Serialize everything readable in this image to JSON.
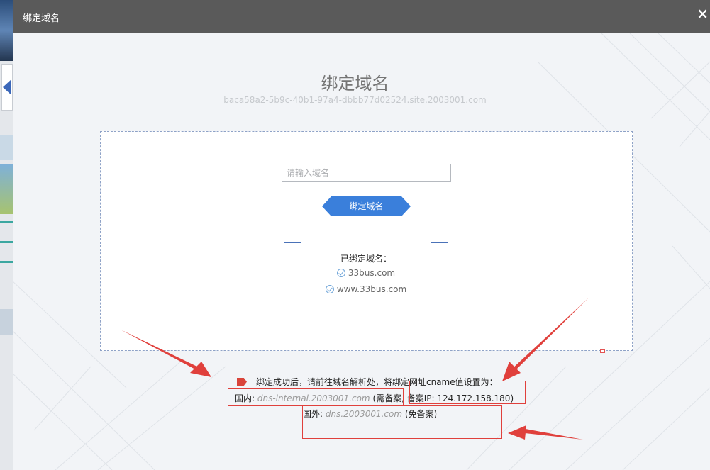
{
  "dialog": {
    "title": "绑定域名",
    "close_glyph": "×"
  },
  "main": {
    "heading": "绑定域名",
    "subtitle": "baca58a2-5b9c-40b1-97a4-dbbb77d02524.site.2003001.com"
  },
  "form": {
    "input_placeholder": "请输入域名",
    "input_value": "",
    "bind_button_label": "绑定域名"
  },
  "bound": {
    "label": "已绑定域名：",
    "domains": [
      "33bus.com",
      "www.33bus.com"
    ]
  },
  "instructions": {
    "intro": "绑定成功后，请前往域名解析处，将绑定网址cname值设置为：",
    "domestic_label": "国内: ",
    "domestic_host": "dns-internal.2003001.com",
    "domestic_note": " (需备案, 备案IP: 124.172.158.180)",
    "foreign_label": "国外: ",
    "foreign_host": "dns.2003001.com",
    "foreign_note": " (免备案)"
  },
  "colors": {
    "titlebar": "#5a5a5a",
    "button": "#3a7fdb",
    "annotation_red": "#e0403c"
  },
  "icons": [
    "close-icon",
    "check-circle-icon",
    "tag-icon",
    "arrow-annotation"
  ]
}
